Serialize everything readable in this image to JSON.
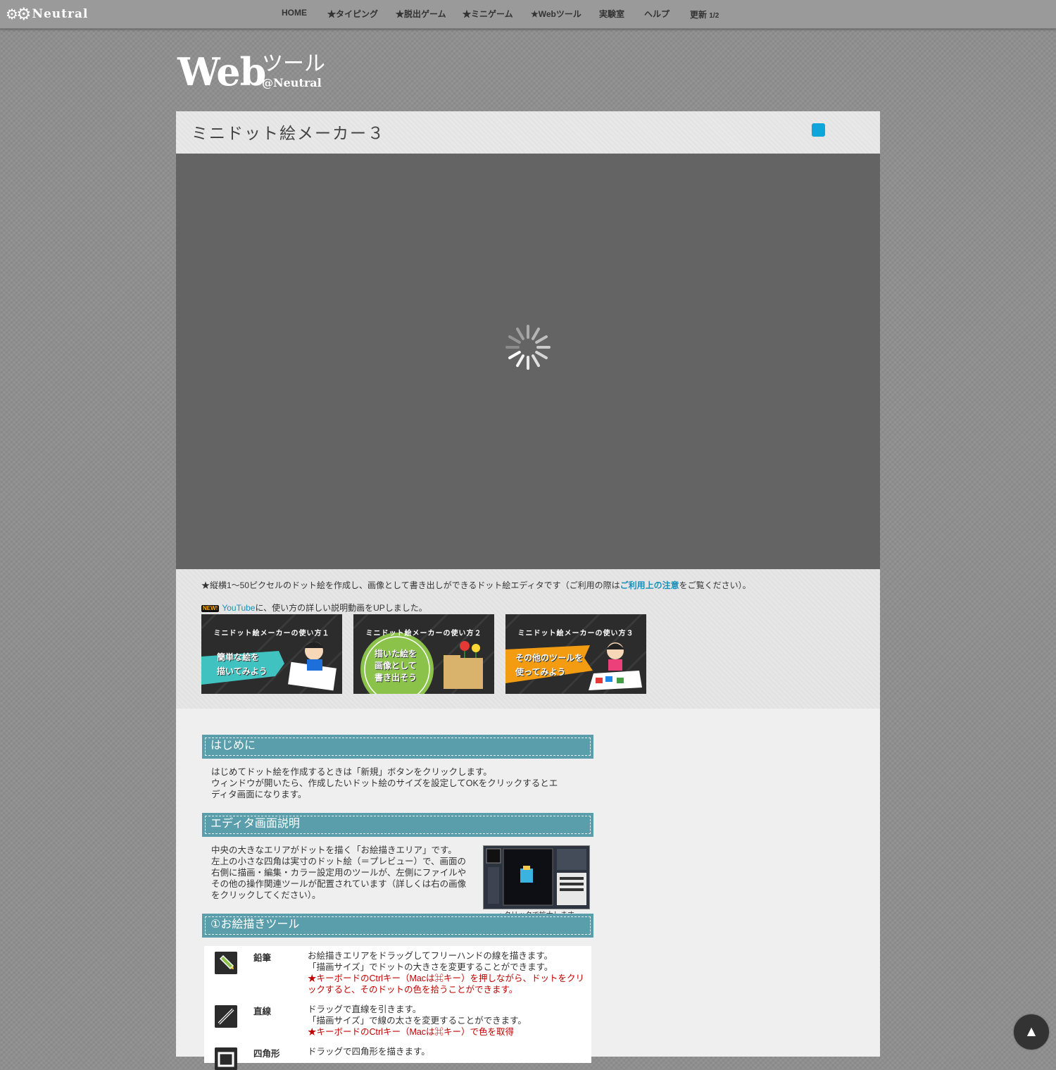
{
  "site": {
    "name": "Neutral",
    "gear_glyph": "⚙"
  },
  "nav": [
    {
      "label": "HOME"
    },
    {
      "label": "★タイピング"
    },
    {
      "label": "★脱出ゲーム"
    },
    {
      "label": "★ミニゲーム"
    },
    {
      "label": "★Webツール"
    },
    {
      "label": "実験室"
    },
    {
      "label": "ヘルプ"
    },
    {
      "label": "更新",
      "suffix": "1/2"
    }
  ],
  "tool_logo": {
    "web": "Web",
    "tool": "ツール",
    "sub": "@Neutral"
  },
  "page": {
    "title": "ミニドット絵メーカー３",
    "badge_color": "#0ea5d8"
  },
  "intro": {
    "text_before": "★縦横1～50ピクセルのドット絵を作成し、画像として書き出しができるドット絵エディタです（ご利用の際は",
    "link": "ご利用上の注意",
    "text_after": "をご覧ください）。",
    "new_badge": "NEW!",
    "youtube": "YouTube",
    "news_text": "に、使い方の詳しい説明動画をUPしました。"
  },
  "videos": [
    {
      "title": "ミニドット絵メーカーの使い方１",
      "caption_1": "簡単な絵を",
      "caption_2": "描いてみよう",
      "color": "#3fc2c0"
    },
    {
      "title": "ミニドット絵メーカーの使い方２",
      "caption_1": "描いた絵を",
      "caption_2": "画像として",
      "caption_3": "書き出そう",
      "color": "#8bc34a"
    },
    {
      "title": "ミニドット絵メーカーの使い方３",
      "caption_1": "その他のツールを",
      "caption_2": "使ってみよう",
      "color": "#f39c12"
    }
  ],
  "sections": {
    "intro_head": "はじめに",
    "intro_lines": [
      "はじめてドット絵を作成するときは「新規」ボタンをクリックします。",
      "ウィンドウが開いたら、作成したいドット絵のサイズを設定してOKをクリックするとエ",
      "ディタ画面になります。"
    ],
    "editor_head": "エディタ画面説明",
    "editor_lines": [
      "中央の大きなエリアがドットを描く「お絵描きエリア」です。",
      "左上の小さな四角は実寸のドット絵（＝プレビュー）で、画面の",
      "右側に描画・編集・カラー設定用のツールが、左側にファイルや",
      "その他の操作関連ツールが配置されています（詳しくは右の画像",
      "をクリックしてください）。"
    ],
    "editor_caption": "▲クリックで拡大します",
    "tools_head": "①お絵描きツール"
  },
  "tools": [
    {
      "name": "鉛筆",
      "icon": "pencil-icon",
      "lines": [
        "お絵描きエリアをドラッグしてフリーハンドの線を描きます。",
        "「描画サイズ」でドットの大きさを変更することができます。"
      ],
      "note": "★キーボードのCtrlキー（Macは⌘キー）を押しながら、ドットをクリックすると、そのドットの色を拾うことができます。"
    },
    {
      "name": "直線",
      "icon": "line-icon",
      "lines": [
        "ドラッグで直線を引きます。",
        "「描画サイズ」で線の太さを変更することができます。"
      ],
      "note": "★キーボードのCtrlキー（Macは⌘キー）で色を取得"
    },
    {
      "name": "四角形",
      "icon": "rectangle-icon",
      "lines": [
        "ドラッグで四角形を描きます。"
      ],
      "note": ""
    }
  ],
  "back_to_top": "▲"
}
